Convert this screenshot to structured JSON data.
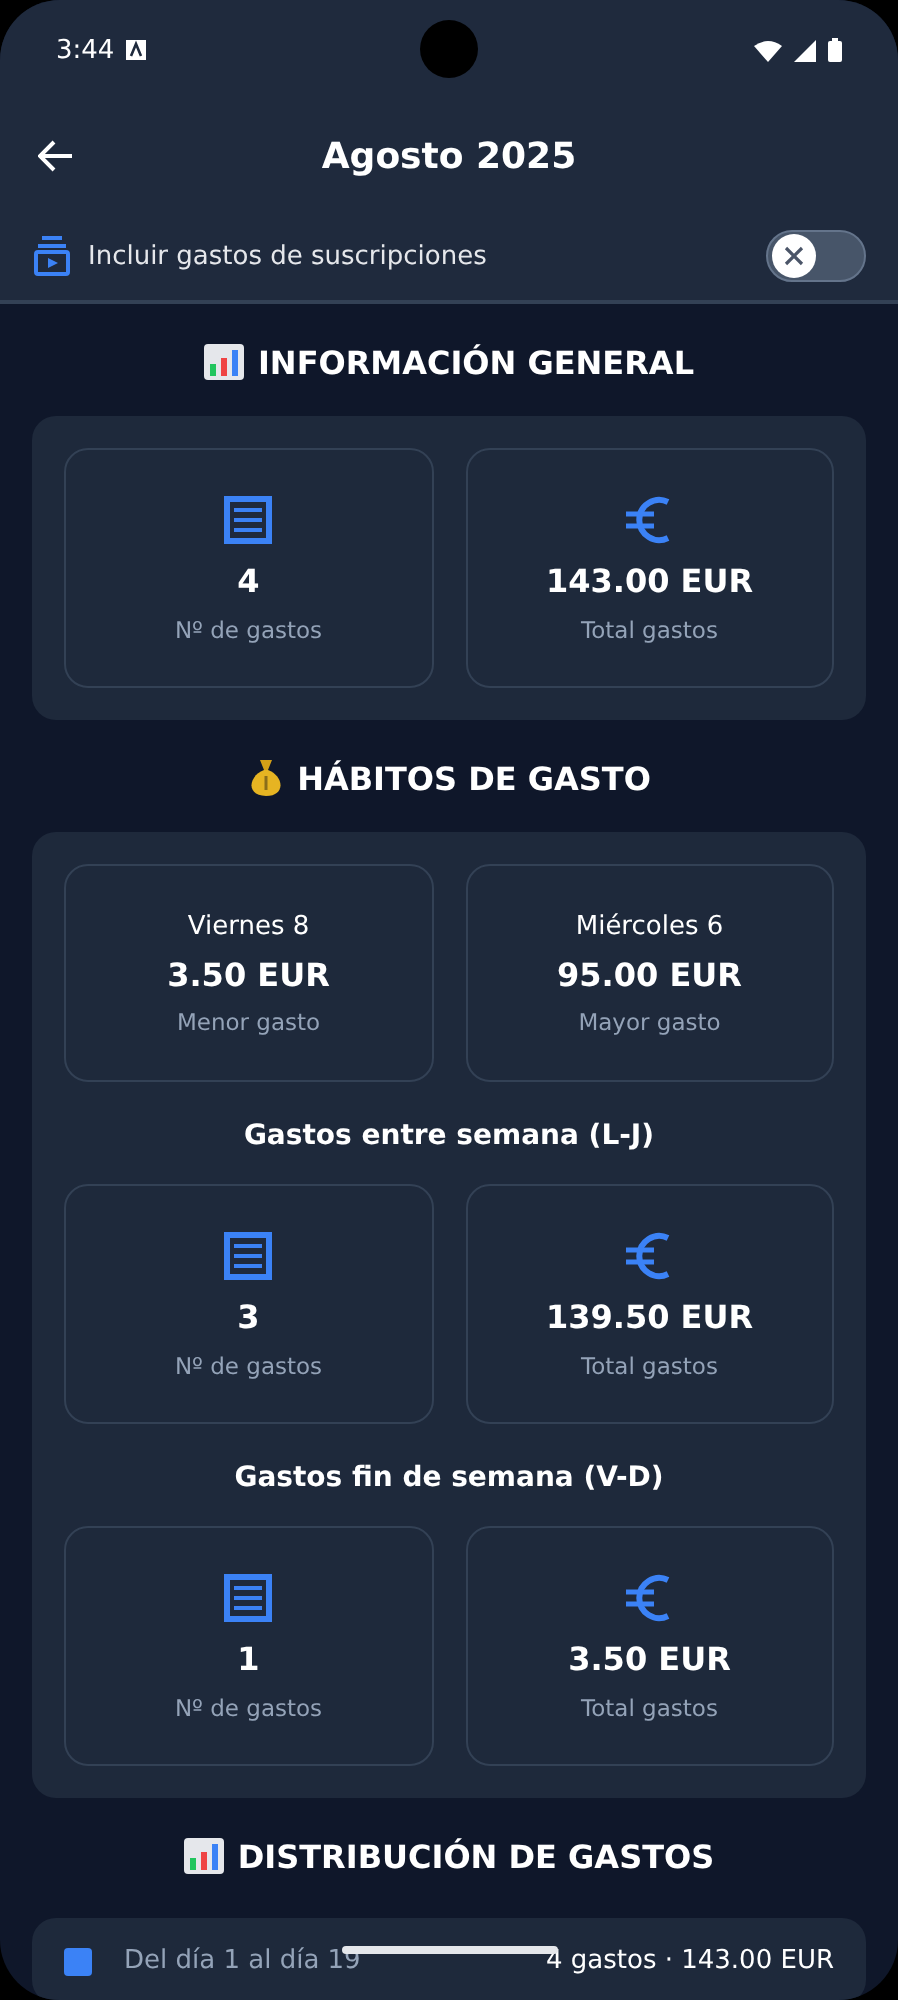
{
  "status_bar": {
    "time": "3:44"
  },
  "header": {
    "title": "Agosto 2025"
  },
  "subscriptions_toggle": {
    "label": "Incluir gastos de suscripciones",
    "checked": false
  },
  "general": {
    "title": "INFORMACIÓN GENERAL",
    "stats": [
      {
        "kind": "receipt",
        "value": "4",
        "label": "Nº de gastos"
      },
      {
        "kind": "euro",
        "value": "143.00 EUR",
        "label": "Total gastos"
      }
    ]
  },
  "habits": {
    "title": "HÁBITOS DE GASTO",
    "extremes": [
      {
        "day": "Viernes 8",
        "value": "3.50 EUR",
        "label": "Menor gasto"
      },
      {
        "day": "Miércoles 6",
        "value": "95.00 EUR",
        "label": "Mayor gasto"
      }
    ],
    "groups": [
      {
        "title": "Gastos entre semana (L-J)",
        "stats": [
          {
            "kind": "receipt",
            "value": "3",
            "label": "Nº de gastos"
          },
          {
            "kind": "euro",
            "value": "139.50 EUR",
            "label": "Total gastos"
          }
        ]
      },
      {
        "title": "Gastos fin de semana (V-D)",
        "stats": [
          {
            "kind": "receipt",
            "value": "1",
            "label": "Nº de gastos"
          },
          {
            "kind": "euro",
            "value": "3.50 EUR",
            "label": "Total gastos"
          }
        ]
      }
    ]
  },
  "distribution": {
    "title": "DISTRIBUCIÓN DE GASTOS",
    "rows": [
      {
        "range": "Del día 1 al día 19",
        "summary": "4 gastos · 143.00 EUR"
      }
    ]
  }
}
